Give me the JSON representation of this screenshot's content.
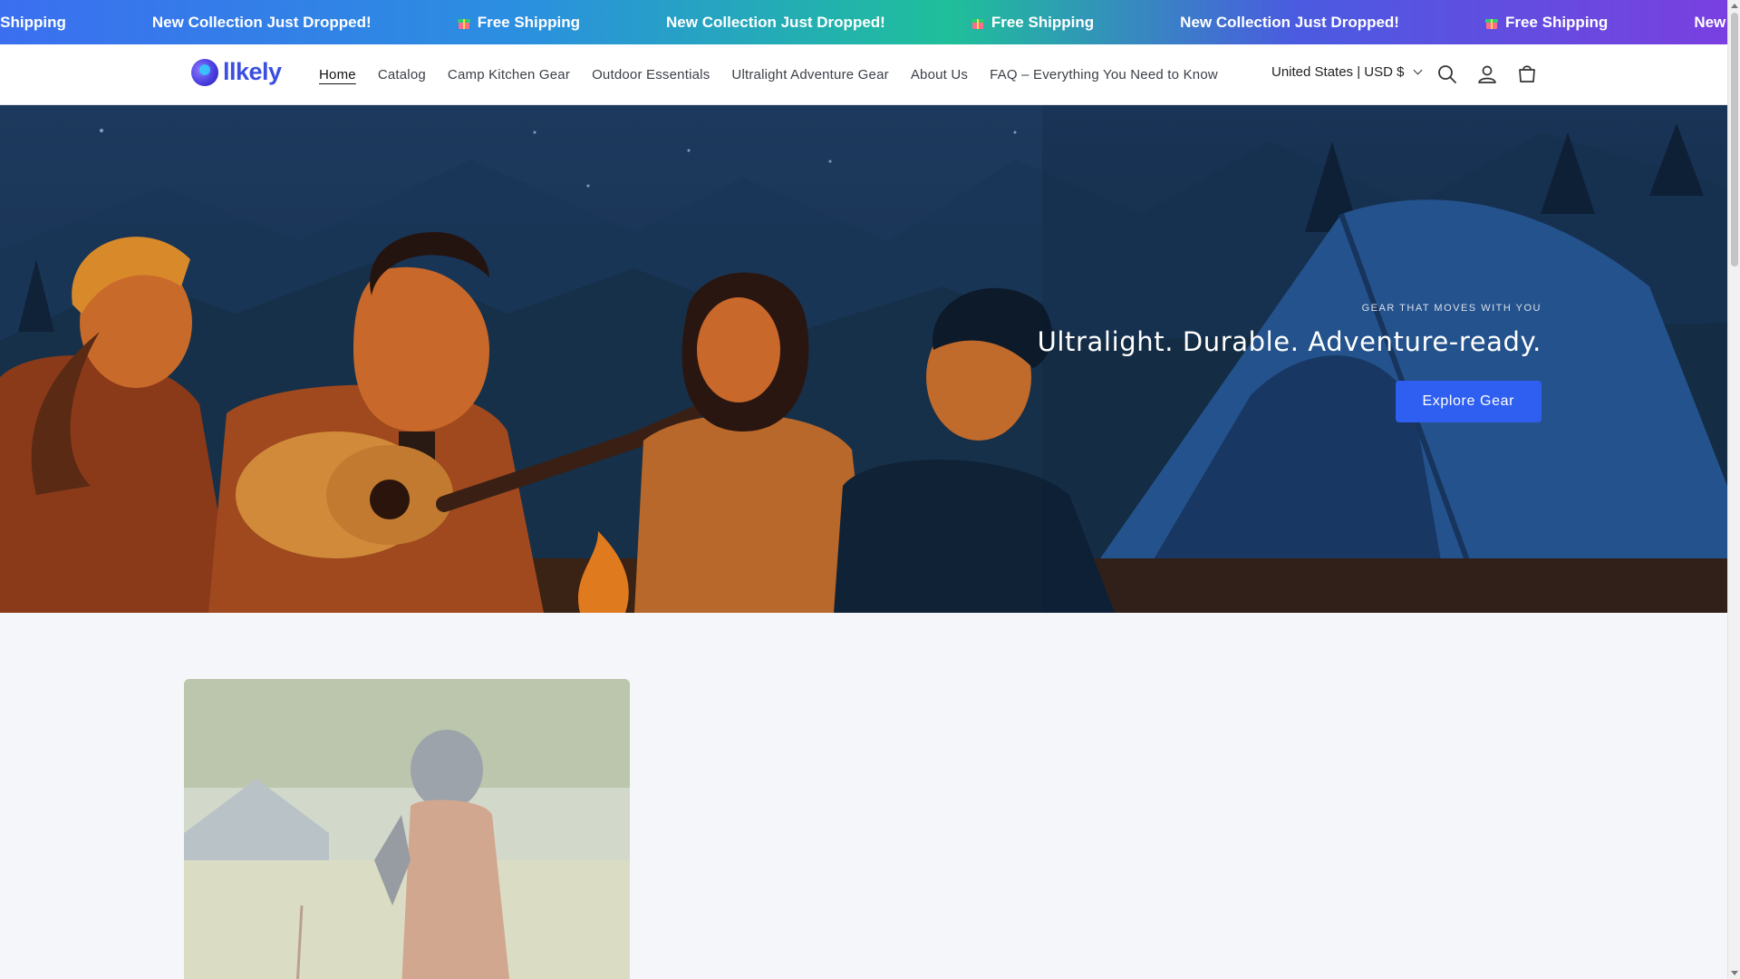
{
  "announcement": {
    "items": [
      {
        "text": "e Shipping",
        "gift": false
      },
      {
        "text": "New Collection Just Dropped!",
        "gift": false
      },
      {
        "text": "Free Shipping",
        "gift": true
      },
      {
        "text": "New Collection Just Dropped!",
        "gift": false
      },
      {
        "text": "Free Shipping",
        "gift": true
      },
      {
        "text": "New Collection Just Dropped!",
        "gift": false
      },
      {
        "text": "Free Shipping",
        "gift": true
      },
      {
        "text": "New Colle",
        "gift": false
      }
    ]
  },
  "header": {
    "logo_text": "llkely",
    "nav": [
      "Home",
      "Catalog",
      "Camp Kitchen Gear",
      "Outdoor Essentials",
      "Ultralight Adventure Gear",
      "About Us",
      "FAQ – Everything You Need to Know"
    ],
    "active_nav": "Home",
    "country": "United States | USD $"
  },
  "hero": {
    "eyebrow": "GEAR THAT MOVES WITH YOU",
    "title": "Ultralight. Durable. Adventure-ready.",
    "button": "Explore Gear"
  },
  "colors": {
    "accent": "#2f5ff0",
    "brand": "#3b4fe0",
    "hero_bg": "#173050"
  }
}
